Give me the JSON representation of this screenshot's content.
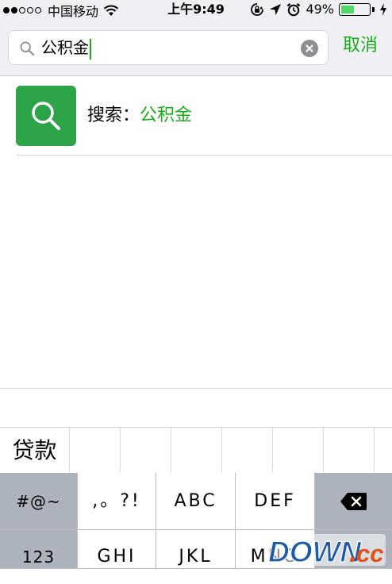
{
  "status_bar": {
    "signal_dots_filled": 2,
    "signal_dots_total": 5,
    "carrier": "中国移动",
    "time": "上午9:49",
    "battery_percent_label": "49%",
    "battery_level": 0.49
  },
  "search": {
    "query": "公积金",
    "cancel_label": "取消"
  },
  "result": {
    "prefix": "搜索：",
    "keyword": "公积金"
  },
  "candidates": [
    "贷款",
    "",
    "",
    "",
    "",
    "",
    "",
    ""
  ],
  "keyboard": {
    "row1": [
      "#@~",
      ",。?!",
      "ABC",
      "DEF",
      "delete-icon"
    ],
    "row2": [
      "123",
      "GHI",
      "JKL",
      "MNO",
      ""
    ]
  },
  "watermark": {
    "text_main": "DOWN",
    "text_dot": ".",
    "text_cc": "cc"
  },
  "colors": {
    "accent_green": "#1aad19",
    "icon_green": "#2ea449",
    "battery_green": "#4cd964"
  }
}
